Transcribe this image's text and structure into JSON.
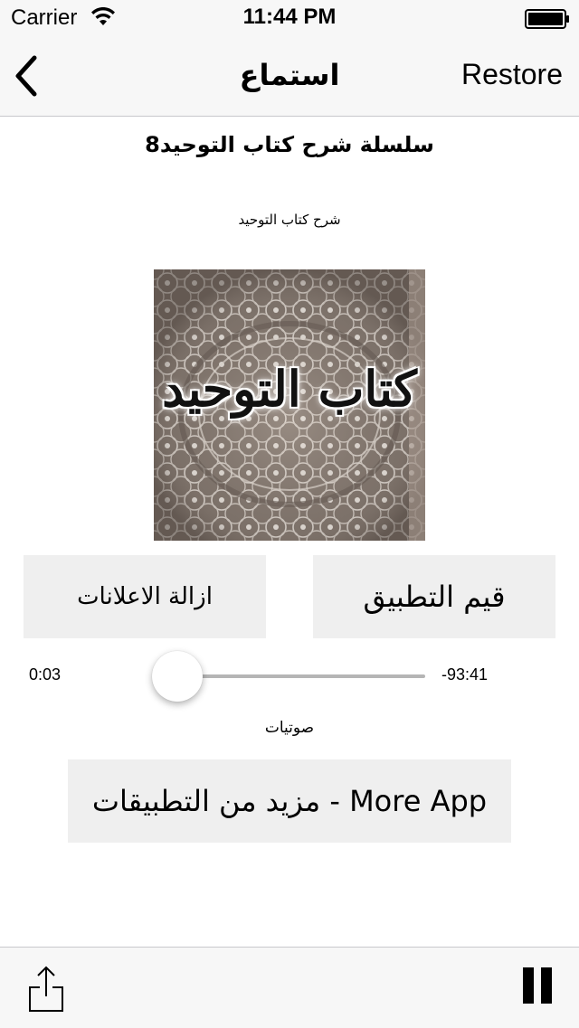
{
  "status_bar": {
    "carrier": "Carrier",
    "time": "11:44 PM"
  },
  "nav": {
    "title": "استماع",
    "restore_label": "Restore"
  },
  "content": {
    "series_title": "سلسلة شرح كتاب التوحيد8",
    "subtitle": "شرح كتاب التوحيد",
    "cover_text": "كتاب التوحيد",
    "rate_app_label": "قيم التطبيق",
    "remove_ads_label": "ازالة الاعلانات",
    "audios_label": "صوتيات",
    "more_apps_label": "مزيد من التطبيقات - More App"
  },
  "player": {
    "elapsed": "0:03",
    "remaining": "-93:41",
    "progress_fraction": 0.0005
  },
  "icons": {
    "back": "chevron-left-icon",
    "wifi": "wifi-icon",
    "battery": "battery-icon",
    "share": "share-icon",
    "pause": "pause-icon"
  }
}
